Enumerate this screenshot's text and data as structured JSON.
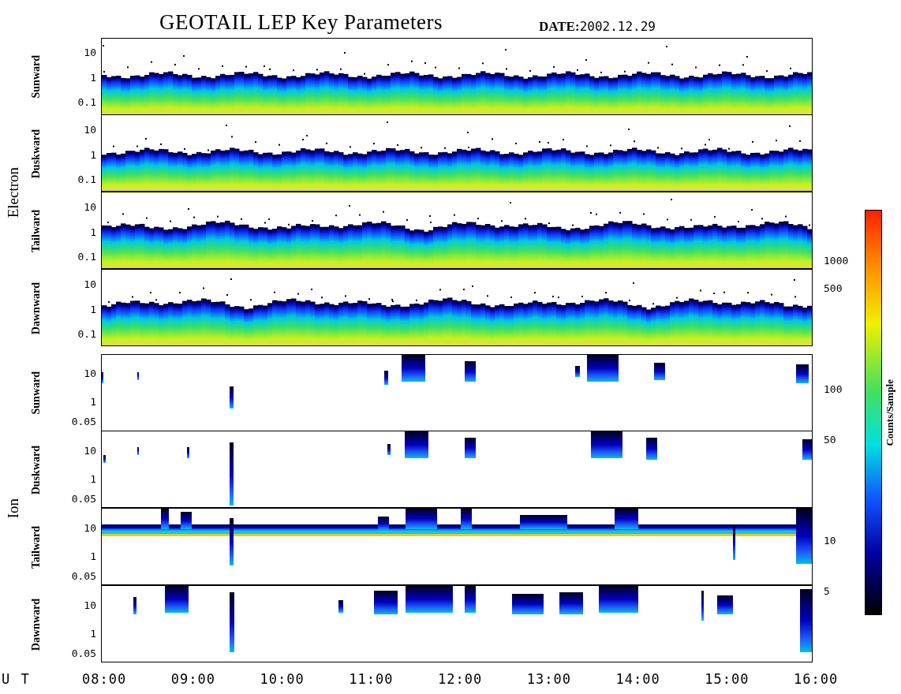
{
  "title": "GEOTAIL LEP Key Parameters",
  "date": {
    "label": "DATE:",
    "value": "2002.12.29"
  },
  "groups": [
    {
      "kind": "electron",
      "label": "Electron",
      "panels": [
        {
          "label": "Sunward",
          "y_ticks": [
            "10",
            "1",
            "0.1"
          ]
        },
        {
          "label": "Duskward",
          "y_ticks": [
            "10",
            "1",
            "0.1"
          ]
        },
        {
          "label": "Tailward",
          "y_ticks": [
            "10",
            "1",
            "0.1"
          ]
        },
        {
          "label": "Dawnward",
          "y_ticks": [
            "10",
            "1",
            "0.1"
          ]
        }
      ]
    },
    {
      "kind": "ion",
      "label": "Ion",
      "panels": [
        {
          "label": "Sunward",
          "y_ticks": [
            "10",
            "1",
            "0.05"
          ]
        },
        {
          "label": "Duskward",
          "y_ticks": [
            "10",
            "1",
            "0.05"
          ]
        },
        {
          "label": "Tailward",
          "y_ticks": [
            "10",
            "1",
            "0.05"
          ]
        },
        {
          "label": "Dawnward",
          "y_ticks": [
            "10",
            "1",
            "0.05"
          ]
        }
      ]
    }
  ],
  "colorbar": {
    "label": "Counts/Sample",
    "ticks": [
      "1000",
      "500",
      "100",
      "50",
      "10",
      "5"
    ]
  },
  "time_axis": {
    "label": "U T",
    "ticks": [
      "08:00",
      "09:00",
      "10:00",
      "11:00",
      "12:00",
      "13:00",
      "14:00",
      "15:00",
      "16:00"
    ]
  }
}
